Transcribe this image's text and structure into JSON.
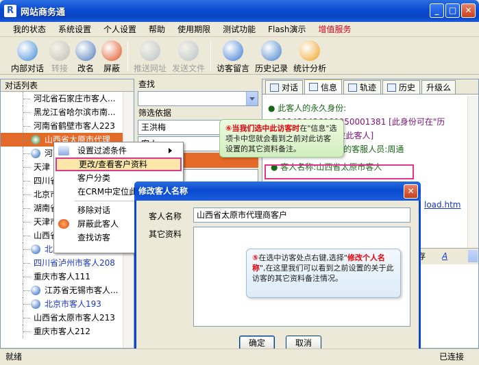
{
  "window": {
    "title": "网站商务通",
    "app_icon": "R"
  },
  "menu": [
    "我的状态",
    "系统设置",
    "个人设置",
    "帮助",
    "使用期限",
    "测试功能",
    "Flash演示",
    "增值服务"
  ],
  "toolbar": [
    {
      "label": "内部对话",
      "icon": "users-icon",
      "color": "#3d88d8",
      "disabled": false
    },
    {
      "label": "转接",
      "icon": "transfer-icon",
      "color": "#888888",
      "disabled": true
    },
    {
      "label": "改名",
      "icon": "rename-icon",
      "color": "#4a78b8",
      "disabled": false
    },
    {
      "label": "屏蔽",
      "icon": "block-icon",
      "color": "#e05020",
      "disabled": false
    },
    {
      "label": "推送网址",
      "icon": "push-url-icon",
      "color": "#7890b0",
      "disabled": true
    },
    {
      "label": "发送文件",
      "icon": "send-file-icon",
      "color": "#7890b0",
      "disabled": true
    },
    {
      "label": "访客留言",
      "icon": "message-icon",
      "color": "#3a78d0",
      "disabled": false
    },
    {
      "label": "历史记录",
      "icon": "history-icon",
      "color": "#4080c8",
      "disabled": false
    },
    {
      "label": "统计分析",
      "icon": "stats-icon",
      "color": "#f0a020",
      "disabled": false
    }
  ],
  "left_panel": {
    "header": "对话列表",
    "items": [
      {
        "text": "河北省石家庄市客人...",
        "blue": false,
        "selected": false,
        "pic": false
      },
      {
        "text": "黑龙江省哈尔滨市南...",
        "blue": false,
        "selected": false,
        "pic": false
      },
      {
        "text": "河南省鹤壁市客人223",
        "blue": false,
        "selected": false,
        "pic": false
      },
      {
        "text": "山西省太原市代理",
        "blue": false,
        "selected": true,
        "pic": true
      },
      {
        "text": "河",
        "blue": false,
        "selected": false,
        "pic": true
      },
      {
        "text": "天津",
        "blue": false,
        "selected": false,
        "pic": false
      },
      {
        "text": "四川省",
        "blue": false,
        "selected": false,
        "pic": false
      },
      {
        "text": "北京市",
        "blue": false,
        "selected": false,
        "pic": false
      },
      {
        "text": "湖南省",
        "blue": false,
        "selected": false,
        "pic": false
      },
      {
        "text": "天津市",
        "blue": false,
        "selected": false,
        "pic": false
      },
      {
        "text": "山西省",
        "blue": false,
        "selected": false,
        "pic": false
      },
      {
        "text": "北京市海淀区客人",
        "blue": true,
        "selected": false,
        "pic": true
      },
      {
        "text": "四川省泸州市客人208",
        "blue": true,
        "selected": false,
        "pic": false
      },
      {
        "text": "重庆市客人111",
        "blue": false,
        "selected": false,
        "pic": false
      },
      {
        "text": "江苏省无锡市客人...",
        "blue": false,
        "selected": false,
        "pic": true
      },
      {
        "text": "北京市客人193",
        "blue": true,
        "selected": false,
        "pic": true
      },
      {
        "text": "山西省太原市客人213",
        "blue": false,
        "selected": false,
        "pic": false
      },
      {
        "text": "重庆市客人212",
        "blue": false,
        "selected": false,
        "pic": false
      }
    ]
  },
  "mid_panel": {
    "search_label": "查找",
    "filter_label": "筛选依据",
    "filter_value": "王洪梅",
    "field2": "客人",
    "field3": "候"
  },
  "right_panel": {
    "tabs": [
      "对话",
      "信息",
      "轨迹",
      "历史",
      "升级么"
    ],
    "active_tab": 1,
    "info_line1": "● 此客人的永久身份:",
    "info_line2": "200430436060950001381 [此身份可在\"历",
    "info_line3": "史对话\"中用来定位此客人]",
    "info_line4": "● 第一次接待此客人的客服人员:周通",
    "info_name": "● 客人名称:山西省太原市客人",
    "link_text": "load.htm",
    "toolbar_text1": "存",
    "toolbar_text2": "A"
  },
  "context_menu": {
    "items": [
      {
        "label": "设置过滤条件",
        "submenu": true,
        "icon": true
      },
      {
        "label": "更改/查看客户资料",
        "highlight": true
      },
      {
        "label": "客户分类"
      },
      {
        "label": "在CRM中定位此"
      },
      {
        "sep": true
      },
      {
        "label": "移除对话"
      },
      {
        "label": "屏蔽此客人",
        "icon": true
      },
      {
        "label": "查找访客"
      }
    ]
  },
  "dialog": {
    "title": "修改客人名称",
    "name_label": "客人名称",
    "name_value": "山西省太原市代理商客户",
    "other_label": "其它资料",
    "ok": "确定",
    "cancel": "取消"
  },
  "callout1": {
    "num": "⑥",
    "hl": "当我们选中此访客时",
    "text": "在\"信息\"选项卡中您就会看到之前对此访客设置的其它资料备注。"
  },
  "callout2": {
    "num": "⑤",
    "pre": "在选中访客处点右键,选择\"",
    "hl": "修改个人名称",
    "post": "\",在这里我们可以看到之前设置的关于此访客的其它资料备注情况。"
  },
  "status": {
    "left": "就绪",
    "right": "已连接"
  }
}
